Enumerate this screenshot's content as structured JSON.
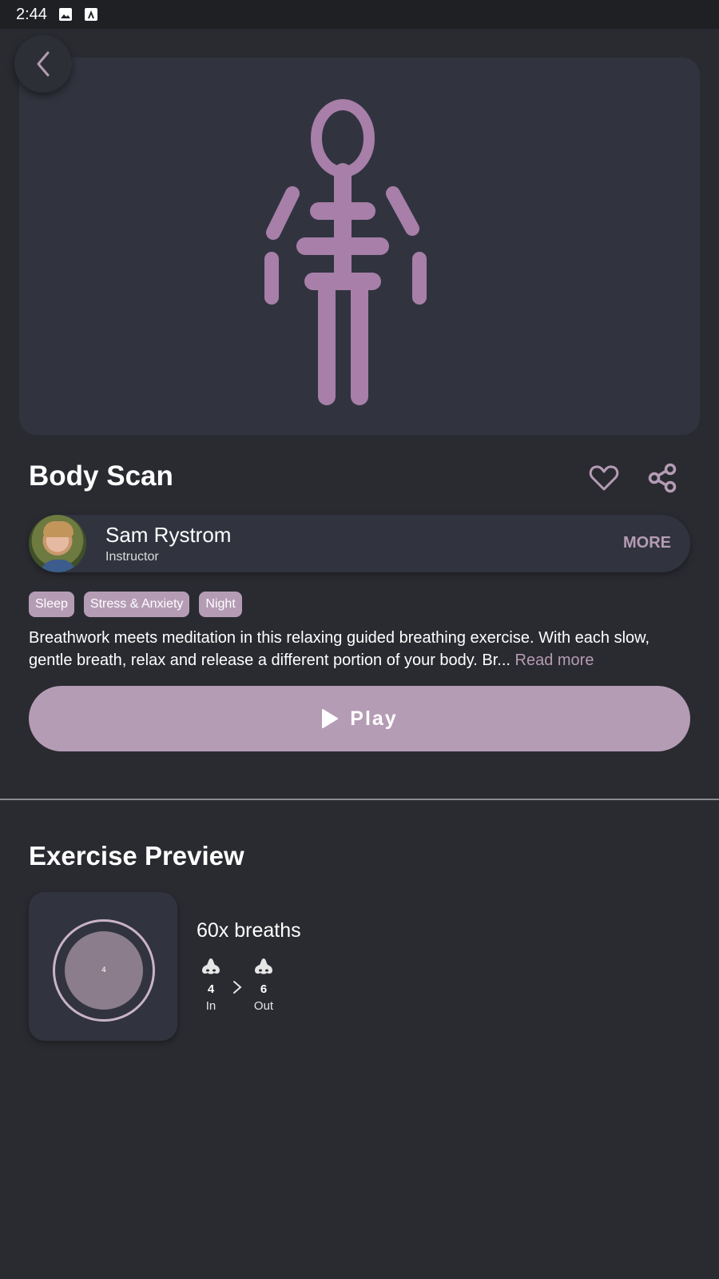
{
  "status_bar": {
    "time": "2:44"
  },
  "exercise": {
    "title": "Body Scan",
    "instructor": {
      "name": "Sam Rystrom",
      "role": "Instructor",
      "more_label": "MORE"
    },
    "tags": [
      "Sleep",
      "Stress & Anxiety",
      "Night"
    ],
    "description": "Breathwork meets meditation in this relaxing guided breathing exercise. With each slow, gentle breath, relax and release a different portion of your body. Br...",
    "read_more": "Read more",
    "play_label": "Play"
  },
  "preview": {
    "section_title": "Exercise Preview",
    "breaths_label": "60x breaths",
    "circle_count": "4",
    "phases": [
      {
        "value": "4",
        "label": "In"
      },
      {
        "value": "6",
        "label": "Out"
      }
    ]
  },
  "colors": {
    "accent": "#b59cb5",
    "figure": "#a77fa9",
    "background": "#2a2b31",
    "card": "#31343f"
  }
}
